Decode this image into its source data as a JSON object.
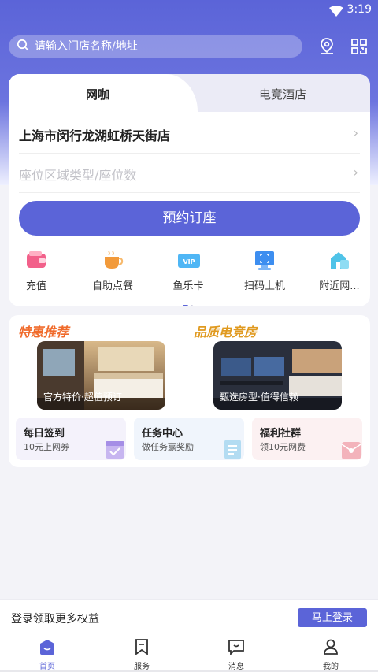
{
  "status_bar": {
    "time": "3:19"
  },
  "header": {
    "search_placeholder": "请输入门店名称/地址",
    "location_icon": "location-pin-icon",
    "scan_icon": "qr-grid-icon"
  },
  "booking": {
    "tabs": [
      {
        "label": "网咖",
        "active": true
      },
      {
        "label": "电竞酒店",
        "active": false
      }
    ],
    "store_name": "上海市闵行龙湖虹桥天街店",
    "seat_placeholder": "座位区域类型/座位数",
    "book_button": "预约订座"
  },
  "quick_actions": [
    {
      "label": "充值",
      "icon": "wallet-icon"
    },
    {
      "label": "自助点餐",
      "icon": "coffee-cup-icon"
    },
    {
      "label": "鱼乐卡",
      "icon": "vip-card-icon"
    },
    {
      "label": "扫码上机",
      "icon": "scan-monitor-icon"
    },
    {
      "label": "附近网...",
      "icon": "nearby-building-icon"
    }
  ],
  "promos": {
    "left": {
      "title": "特惠推荐",
      "caption": "官方特价·超值预订"
    },
    "right": {
      "title": "品质电竞房",
      "caption": "甄选房型·值得信赖"
    }
  },
  "tiles": [
    {
      "title": "每日签到",
      "subtitle": "10元上网券",
      "icon": "calendar-check-icon"
    },
    {
      "title": "任务中心",
      "subtitle": "做任务赢奖励",
      "icon": "task-list-icon"
    },
    {
      "title": "福利社群",
      "subtitle": "领10元网费",
      "icon": "red-envelope-icon"
    }
  ],
  "login_bar": {
    "text": "登录领取更多权益",
    "button": "马上登录"
  },
  "tab_bar": [
    {
      "label": "首页",
      "icon": "home-icon",
      "active": true
    },
    {
      "label": "服务",
      "icon": "bookmark-icon",
      "active": false
    },
    {
      "label": "消息",
      "icon": "message-icon",
      "active": false
    },
    {
      "label": "我的",
      "icon": "user-icon",
      "active": false
    }
  ],
  "colors": {
    "brand": "#5b64d8",
    "promo_orange": "#f06a2a",
    "promo_gold": "#e09a20"
  }
}
